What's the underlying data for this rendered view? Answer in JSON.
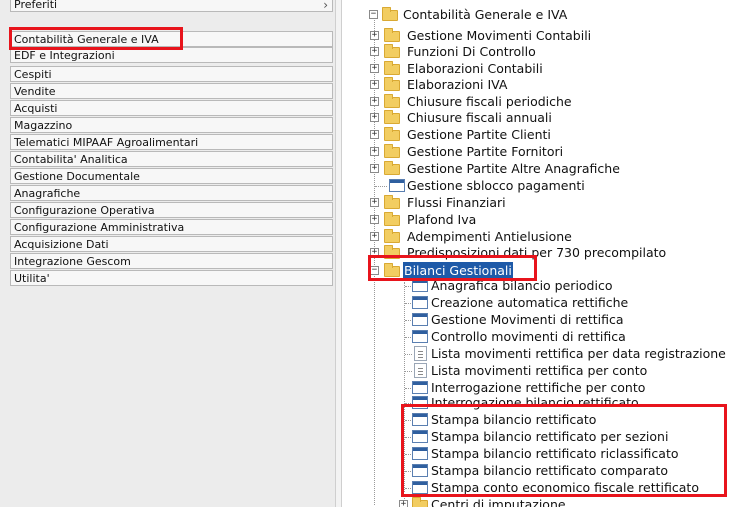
{
  "left_menu": {
    "items": [
      {
        "label": "Preferiti",
        "has_arrow": true
      },
      {
        "label": "Contabilità Generale e IVA",
        "has_arrow": false
      },
      {
        "label": "EDF e Integrazioni",
        "has_arrow": false
      },
      {
        "label": "Cespiti",
        "has_arrow": false
      },
      {
        "label": "Vendite",
        "has_arrow": false
      },
      {
        "label": "Acquisti",
        "has_arrow": false
      },
      {
        "label": "Magazzino",
        "has_arrow": false
      },
      {
        "label": "Telematici MIPAAF Agroalimentari",
        "has_arrow": false
      },
      {
        "label": "Contabilita' Analitica",
        "has_arrow": false
      },
      {
        "label": "Gestione Documentale",
        "has_arrow": false
      },
      {
        "label": "Anagrafiche",
        "has_arrow": false
      },
      {
        "label": "Configurazione Operativa",
        "has_arrow": false
      },
      {
        "label": "Configurazione Amministrativa",
        "has_arrow": false
      },
      {
        "label": "Acquisizione Dati",
        "has_arrow": false
      },
      {
        "label": "Integrazione Gescom",
        "has_arrow": false
      },
      {
        "label": "Utilita'",
        "has_arrow": false
      }
    ]
  },
  "tree": {
    "root": {
      "label": "Contabilità Generale e IVA",
      "expander": "−"
    },
    "children": [
      {
        "label": "Gestione Movimenti Contabili",
        "kind": "folder",
        "expander": "+"
      },
      {
        "label": "Funzioni Di Controllo",
        "kind": "folder",
        "expander": "+"
      },
      {
        "label": "Elaborazioni Contabili",
        "kind": "folder",
        "expander": "+"
      },
      {
        "label": "Elaborazioni IVA",
        "kind": "folder",
        "expander": "+"
      },
      {
        "label": "Chiusure fiscali periodiche",
        "kind": "folder",
        "expander": "+"
      },
      {
        "label": "Chiusure fiscali annuali",
        "kind": "folder",
        "expander": "+"
      },
      {
        "label": "Gestione Partite Clienti",
        "kind": "folder",
        "expander": "+"
      },
      {
        "label": "Gestione Partite Fornitori",
        "kind": "folder",
        "expander": "+"
      },
      {
        "label": "Gestione Partite Altre Anagrafiche",
        "kind": "folder",
        "expander": "+"
      },
      {
        "label": "Gestione sblocco pagamenti",
        "kind": "window",
        "expander": ""
      },
      {
        "label": "Flussi Finanziari",
        "kind": "folder",
        "expander": "+"
      },
      {
        "label": "Plafond Iva",
        "kind": "folder",
        "expander": "+"
      },
      {
        "label": "Adempimenti Antielusione",
        "kind": "folder",
        "expander": "+"
      },
      {
        "label": "Predisposizioni dati per 730 precompilato",
        "kind": "folder",
        "expander": "+"
      },
      {
        "label": "Bilanci Gestionali",
        "kind": "folder",
        "expander": "−",
        "selected": true
      }
    ],
    "bilanci_children": [
      {
        "label": "Anagrafica bilancio periodico",
        "kind": "window"
      },
      {
        "label": "Creazione automatica rettifiche",
        "kind": "window"
      },
      {
        "label": "Gestione Movimenti di rettifica",
        "kind": "window"
      },
      {
        "label": "Controllo movimenti di rettifica",
        "kind": "window"
      },
      {
        "label": "Lista movimenti rettifica per data registrazione",
        "kind": "list"
      },
      {
        "label": "Lista movimenti rettifica per conto",
        "kind": "list"
      },
      {
        "label": "Interrogazione rettifiche per conto",
        "kind": "window"
      },
      {
        "label": "Interrogazione bilancio rettificato",
        "kind": "window"
      },
      {
        "label": "Stampa bilancio rettificato",
        "kind": "window"
      },
      {
        "label": "Stampa bilancio rettificato per sezioni",
        "kind": "window"
      },
      {
        "label": "Stampa bilancio rettificato riclassificato",
        "kind": "window"
      },
      {
        "label": "Stampa bilancio rettificato comparato",
        "kind": "window"
      },
      {
        "label": "Stampa conto economico fiscale rettificato",
        "kind": "window"
      }
    ],
    "after": {
      "label": "Centri di imputazione",
      "kind": "folder",
      "expander": "+"
    }
  },
  "colors": {
    "highlight_red": "#e8141c",
    "selection_blue": "#1e5aa8",
    "folder_yellow": "#f2cd61"
  }
}
